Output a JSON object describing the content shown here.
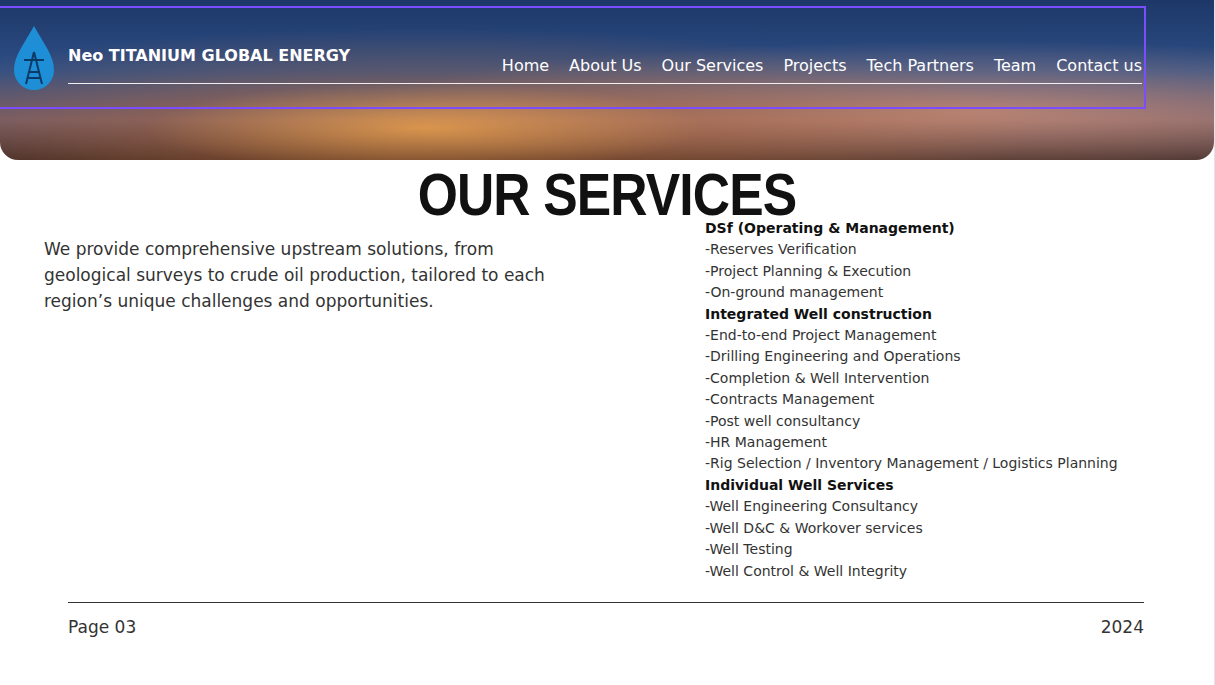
{
  "nav": {
    "brand": "Neo TITANIUM GLOBAL ENERGY",
    "selected": true,
    "links": [
      "Home",
      "About Us",
      "Our Services",
      "Projects",
      "Tech Partners",
      "Team",
      "Contact us"
    ]
  },
  "heading": "OUR SERVICES",
  "intro": "We provide comprehensive upstream solutions, from geological surveys to crude oil production, tailored to each region’s unique challenges and opportunities.",
  "service_groups": [
    {
      "title": "DSf (Operating & Management)",
      "items": [
        "-Reserves Verification",
        "-Project Planning & Execution",
        "-On-ground management"
      ]
    },
    {
      "title": "Integrated Well construction",
      "items": [
        "-End-to-end Project Management",
        "-Drilling Engineering and Operations",
        "-Completion & Well Intervention",
        "-Contracts Management",
        "-Post well consultancy",
        "-HR Management",
        "-Rig Selection / Inventory Management / Logistics Planning"
      ]
    },
    {
      "title": "Individual Well Services",
      "items": [
        "-Well Engineering Consultancy",
        "-Well D&C & Workover services",
        "-Well Testing",
        "-Well Control & Well Integrity"
      ]
    }
  ],
  "footer": {
    "page": "Page 03",
    "year": "2024"
  }
}
